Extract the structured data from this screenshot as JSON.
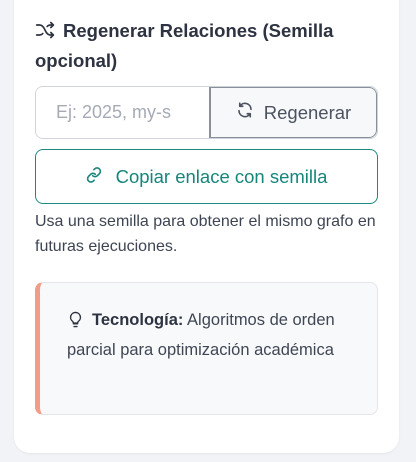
{
  "panel": {
    "title": "Regenerar Relaciones (Semilla opcional)",
    "icon": "shuffle-icon"
  },
  "seed": {
    "placeholder": "Ej: 2025, my-s",
    "value": ""
  },
  "buttons": {
    "regenerate_label": "Regenerar",
    "regenerate_icon": "refresh-icon",
    "copy_label": "Copiar enlace con semilla",
    "copy_icon": "link-icon"
  },
  "hint": "Usa una semilla para obtener el mismo grafo en futuras ejecuciones.",
  "tip": {
    "icon": "lightbulb-icon",
    "label": "Tecnología:",
    "text": " Algoritmos de orden parcial para optimización académica"
  },
  "colors": {
    "accent": "#16857a",
    "tip_border": "#f29b86"
  }
}
